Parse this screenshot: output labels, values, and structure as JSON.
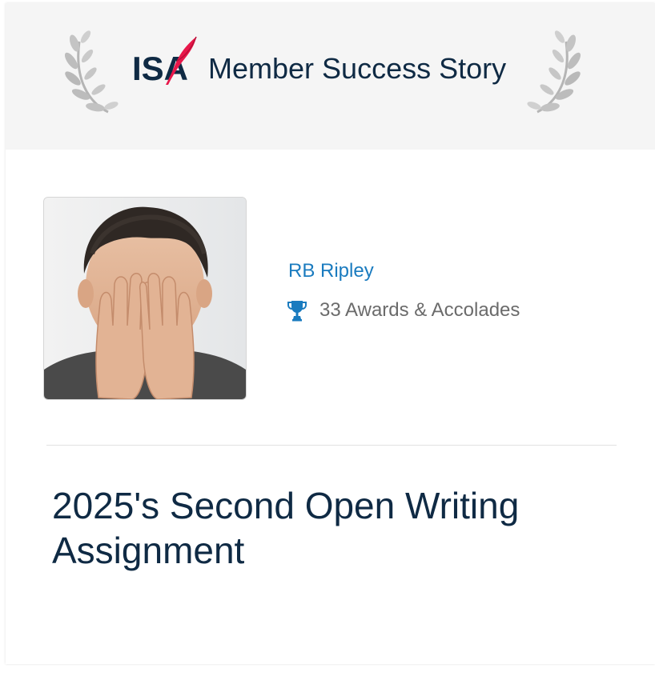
{
  "banner": {
    "logo_text": "ISA",
    "title": "Member Success Story",
    "accent_color": "#e8174a"
  },
  "member": {
    "name": "RB Ripley",
    "awards_text": "33 Awards & Accolades",
    "awards_icon": "trophy-icon",
    "link_color": "#1a7bbf"
  },
  "story": {
    "title": "2025's Second Open Writing Assignment"
  }
}
